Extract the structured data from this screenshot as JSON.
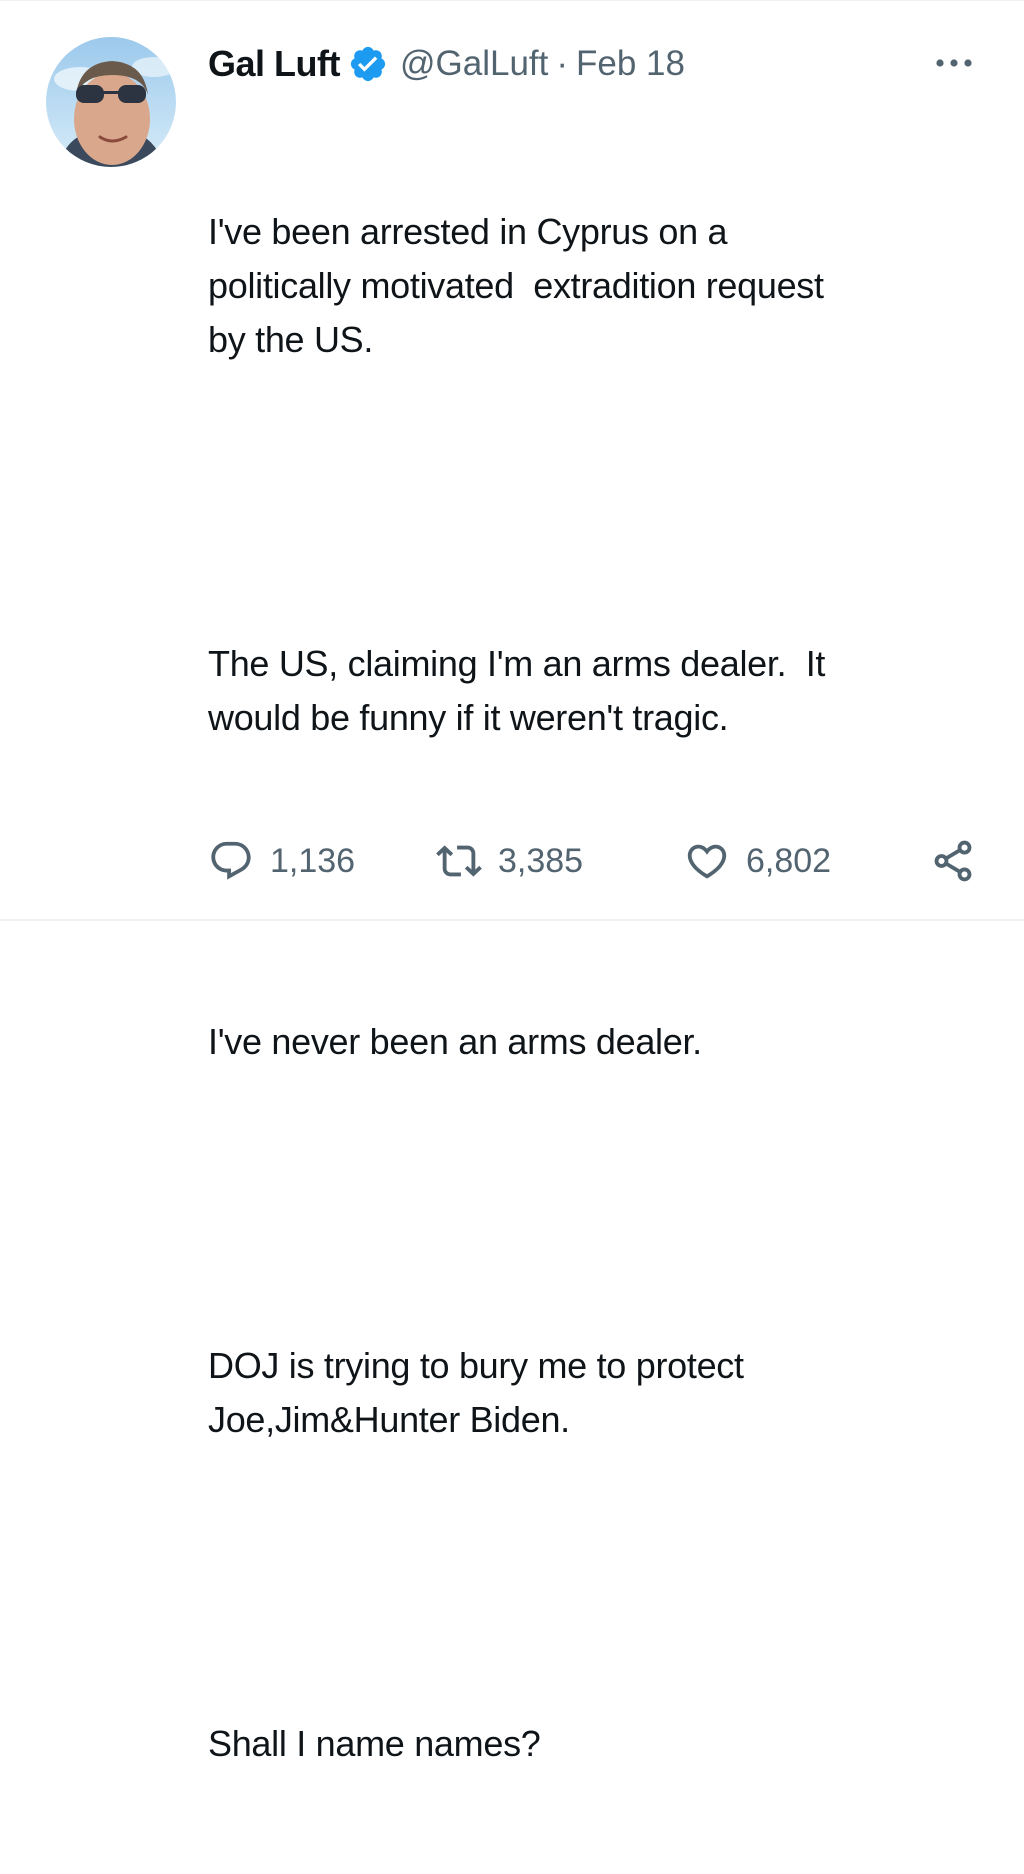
{
  "author": {
    "display_name": "Gal Luft",
    "handle": "@GalLuft",
    "separator": "·",
    "date": "Feb 18",
    "verified": true,
    "verified_color": "#1d9bf0"
  },
  "tweet": {
    "paragraphs": [
      "I've been arrested in Cyprus on a\npolitically motivated  extradition request\nby the US.",
      "The US, claiming I'm an arms dealer.  It\nwould be funny if it weren't tragic.",
      "I've never been an arms dealer.",
      "DOJ is trying to bury me to protect\nJoe,Jim&Hunter Biden.",
      "Shall I name names?"
    ]
  },
  "actions": {
    "replies": "1,136",
    "retweets": "3,385",
    "likes": "6,802"
  },
  "icons": {
    "more": "more-horizontal-icon",
    "reply": "reply-icon",
    "retweet": "retweet-icon",
    "like": "heart-icon",
    "share": "share-icon",
    "verified": "verified-badge-icon"
  },
  "colors": {
    "text": "#0f1419",
    "secondary": "#536471",
    "divider": "#eff3f4"
  }
}
